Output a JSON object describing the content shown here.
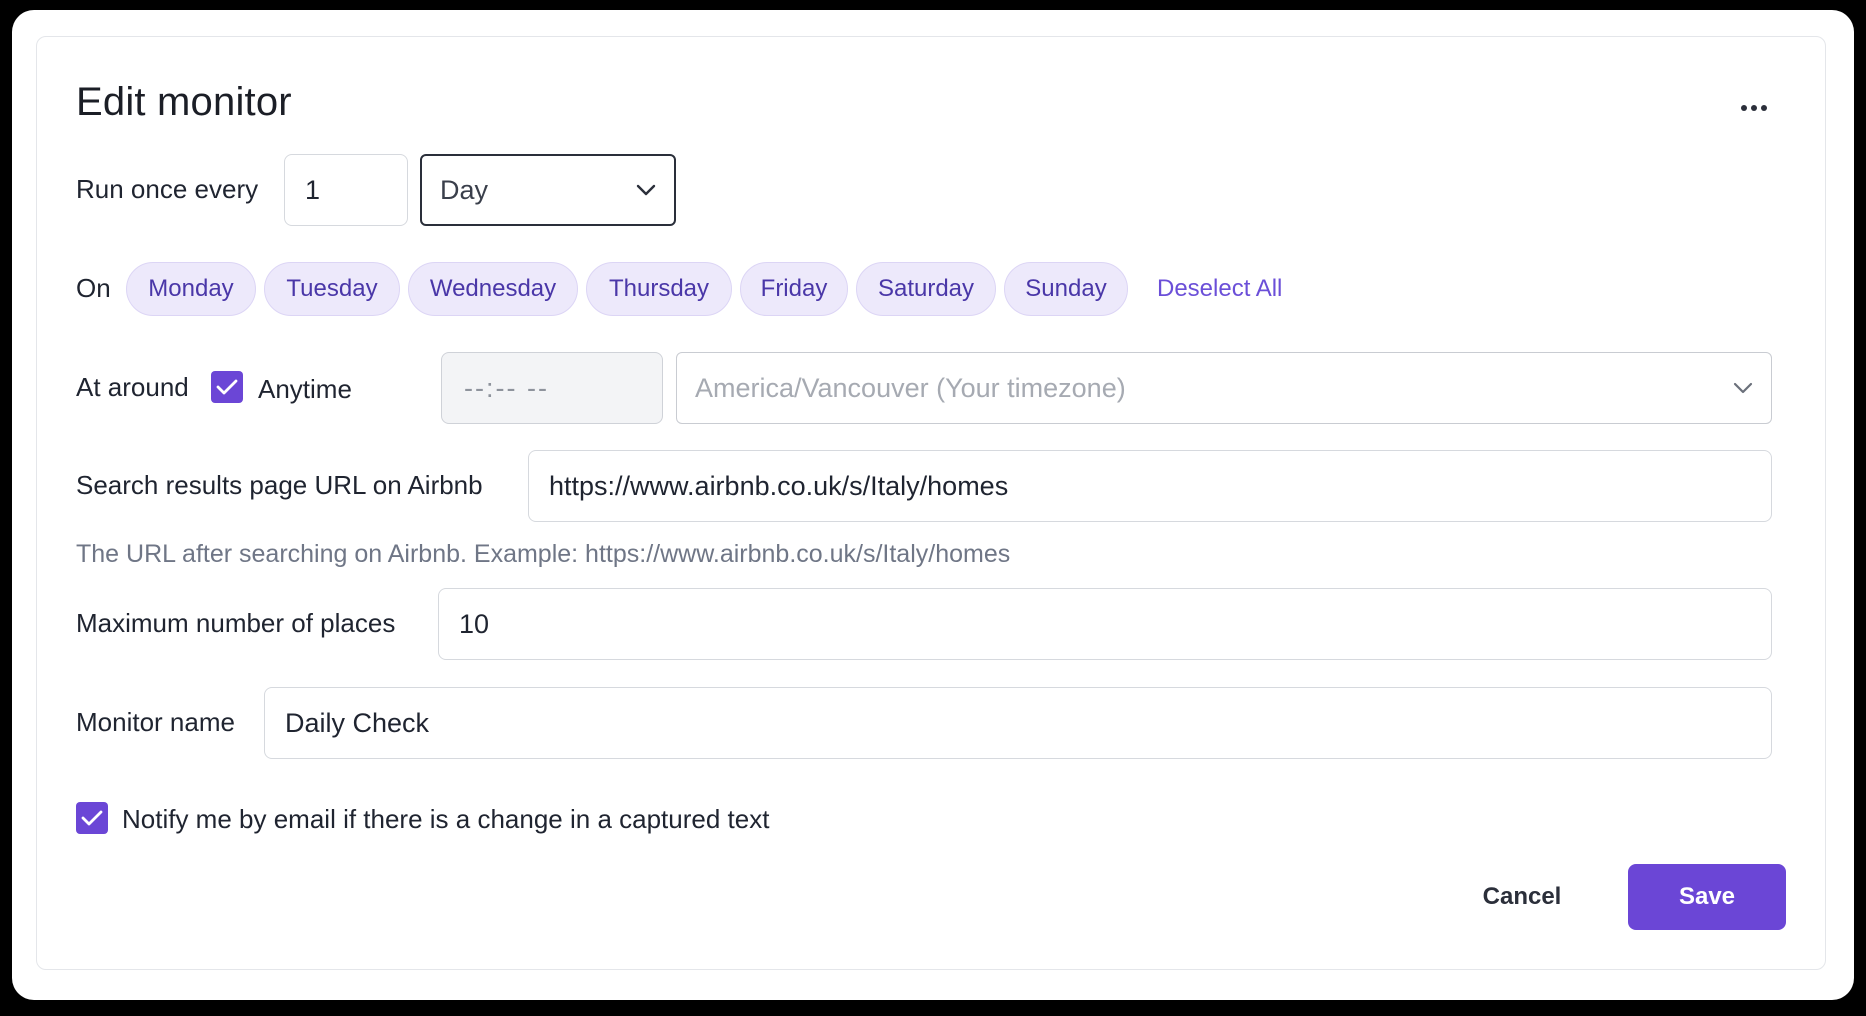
{
  "title": "Edit monitor",
  "schedule": {
    "run_label": "Run once every",
    "interval_value": "1",
    "interval_unit": "Day"
  },
  "days": {
    "on_label": "On",
    "items": [
      "Monday",
      "Tuesday",
      "Wednesday",
      "Thursday",
      "Friday",
      "Saturday",
      "Sunday"
    ],
    "deselect_all": "Deselect All"
  },
  "time": {
    "label": "At around",
    "anytime_label": "Anytime",
    "anytime_checked": true,
    "time_placeholder": "--:-- --",
    "timezone": "America/Vancouver (Your timezone)"
  },
  "url_field": {
    "label": "Search results page URL on Airbnb",
    "value": "https://www.airbnb.co.uk/s/Italy/homes",
    "help": "The URL after searching on Airbnb. Example: https://www.airbnb.co.uk/s/Italy/homes"
  },
  "max_places": {
    "label": "Maximum number of places",
    "value": "10"
  },
  "monitor_name": {
    "label": "Monitor name",
    "value": "Daily Check"
  },
  "notify": {
    "label": "Notify me by email if there is a change in a captured text",
    "checked": true
  },
  "actions": {
    "cancel": "Cancel",
    "save": "Save"
  },
  "colors": {
    "accent": "#6b46d6",
    "chip_bg": "#ede9fb",
    "chip_text": "#4a37a8",
    "help_text": "#6f7686"
  },
  "icons": {
    "more": "more-horizontal-icon",
    "chevron": "chevron-down-icon",
    "check": "checkmark-icon"
  }
}
